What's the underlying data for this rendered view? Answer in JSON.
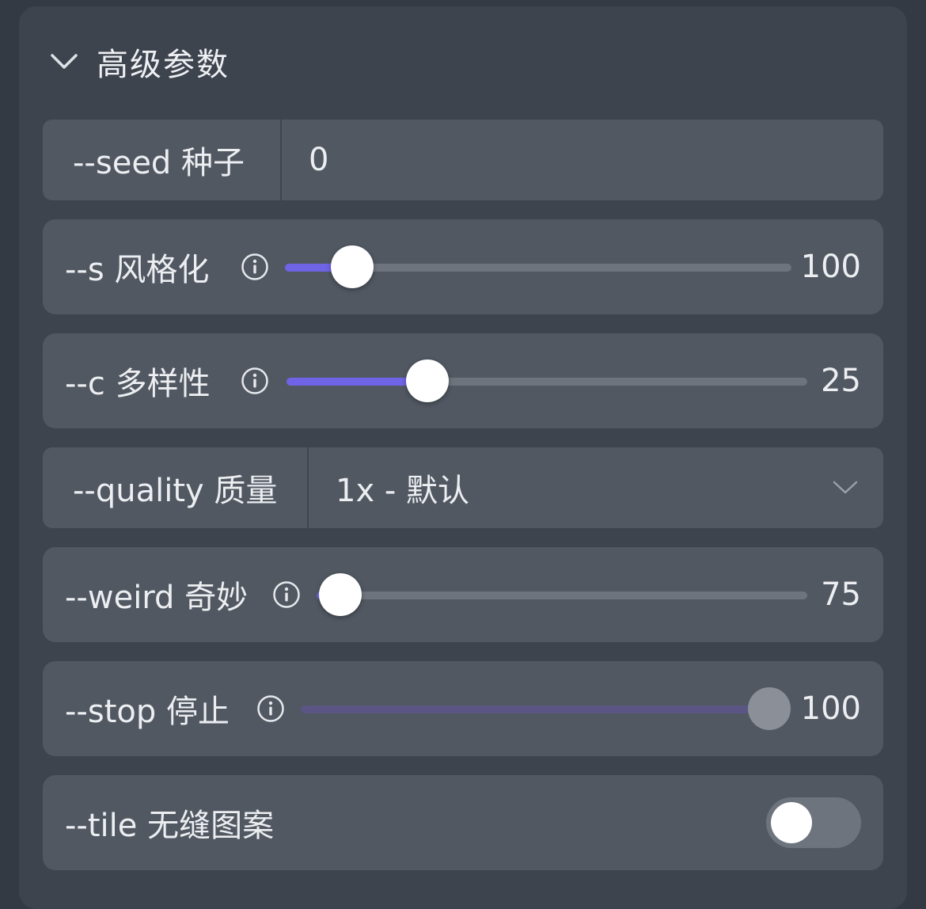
{
  "section": {
    "title": "高级参数"
  },
  "seed": {
    "label": "--seed 种子",
    "value": "0"
  },
  "stylize": {
    "label": "--s 风格化",
    "value": "100",
    "fraction": 0.133
  },
  "chaos": {
    "label": "--c 多样性",
    "value": "25",
    "fraction": 0.27
  },
  "quality": {
    "label": "--quality 质量",
    "value": "1x - 默认"
  },
  "weird": {
    "label": "--weird 奇妙",
    "value": "75",
    "fraction": 0.048
  },
  "stop": {
    "label": "--stop 停止",
    "value": "100",
    "fraction": 1.0
  },
  "tile": {
    "label": "--tile 无缝图案",
    "on": false
  },
  "colors": {
    "accent": "#6f63e6",
    "panel": "#3e444e",
    "row": "#515862"
  }
}
